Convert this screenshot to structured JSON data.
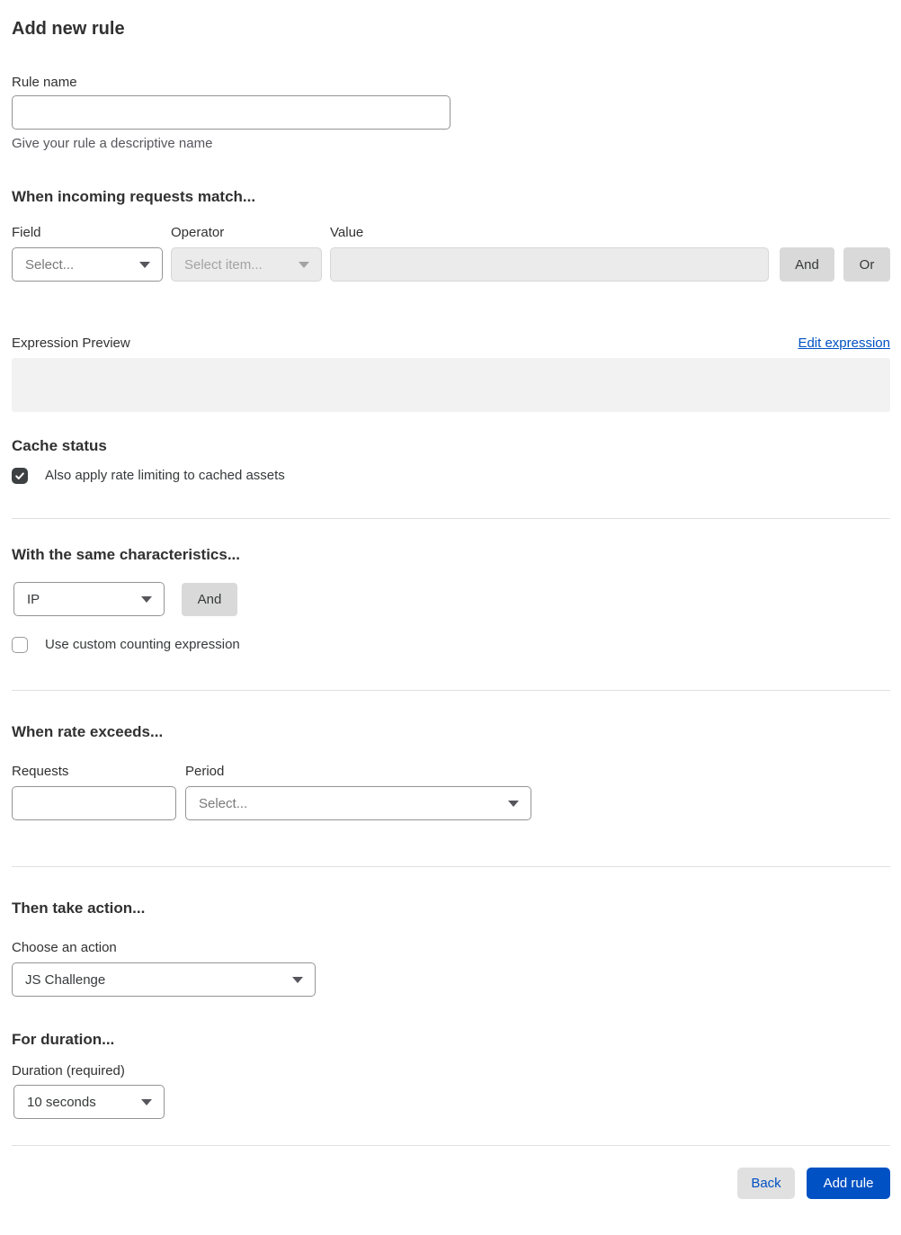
{
  "colors": {
    "accent_blue": "#0051c3",
    "heading": "#313131",
    "body": "#36393a",
    "muted": "#56565c",
    "placeholder": "#797979",
    "disabled_text": "#a3a3a3",
    "border": "#949494",
    "disabled_border": "#d6d6d6",
    "disabled_bg": "#ebebeb",
    "divider": "#e0e0e0",
    "preview_bg": "#f2f2f2",
    "button_gray": "#d9d9d9",
    "checkbox_dark": "#3d4042"
  },
  "page": {
    "title": "Add new rule"
  },
  "rule_name": {
    "label": "Rule name",
    "value": "",
    "helper": "Give your rule a descriptive name"
  },
  "match": {
    "heading": "When incoming requests match...",
    "field_label": "Field",
    "field_value": "Select...",
    "operator_label": "Operator",
    "operator_value": "Select item...",
    "value_label": "Value",
    "value_text": "",
    "and_label": "And",
    "or_label": "Or"
  },
  "expression": {
    "label": "Expression Preview",
    "edit_link": "Edit expression",
    "preview_text": ""
  },
  "cache": {
    "heading": "Cache status",
    "checkbox_label": "Also apply rate limiting to cached assets",
    "checked": true
  },
  "characteristics": {
    "heading": "With the same characteristics...",
    "select_value": "IP",
    "and_label": "And",
    "checkbox_label": "Use custom counting expression",
    "checked": false
  },
  "rate": {
    "heading": "When rate exceeds...",
    "requests_label": "Requests",
    "requests_value": "",
    "period_label": "Period",
    "period_value": "Select..."
  },
  "action": {
    "heading": "Then take action...",
    "label": "Choose an action",
    "value": "JS Challenge"
  },
  "duration": {
    "heading": "For duration...",
    "label": "Duration (required)",
    "value": "10 seconds"
  },
  "footer": {
    "back_label": "Back",
    "submit_label": "Add rule"
  }
}
